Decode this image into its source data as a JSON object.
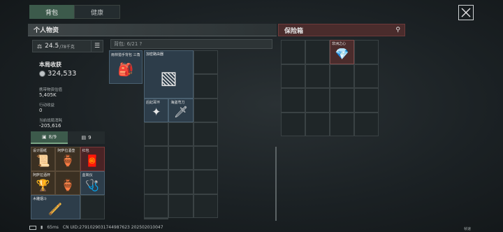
{
  "tabs": [
    {
      "label": "背包"
    },
    {
      "label": "健康"
    }
  ],
  "personal": {
    "header": "个人物资",
    "weight": "24.5",
    "capacity": "/78千克",
    "round_income_title": "本局收获",
    "round_income_value": "324,533",
    "carried_value_label": "携带物资估值",
    "carried_value": "5,405K",
    "action_income_label": "行动收益",
    "action_income": "0",
    "battle_cost_label": "当前战局消耗",
    "battle_cost": "-205,616",
    "strip": [
      {
        "label": "8/9"
      },
      {
        "label": "9"
      }
    ],
    "items": [
      {
        "name": "设计图纸",
        "icon": "📜"
      },
      {
        "name": "阿萨拉酒壶",
        "icon": "🏺"
      },
      {
        "name": "红包",
        "icon": "🧧"
      },
      {
        "name": "阿萨拉酒杯",
        "icon": "🏆"
      },
      {
        "name": "",
        "icon": ""
      },
      {
        "name": "血氧仪",
        "icon": "🩺"
      },
      {
        "name": "木雕烟斗",
        "icon": "🪈"
      }
    ]
  },
  "backpack": {
    "label": "背包: 6/21 ?",
    "bag_name": "雨林猎手背包 三角",
    "items": [
      {
        "name": "加密路由器",
        "icon": "📦"
      },
      {
        "name": "后妃耳环",
        "icon": "✦"
      },
      {
        "name": "海盗弯刀",
        "icon": "🗡"
      }
    ]
  },
  "safe": {
    "header": "保险箱",
    "items": [
      {
        "name": "非洲之心",
        "icon": "💎"
      }
    ]
  },
  "status": {
    "ping": "65ms",
    "uid": "CN UID:279102903174498762​3 20250201004​7",
    "corner": "帧速"
  }
}
